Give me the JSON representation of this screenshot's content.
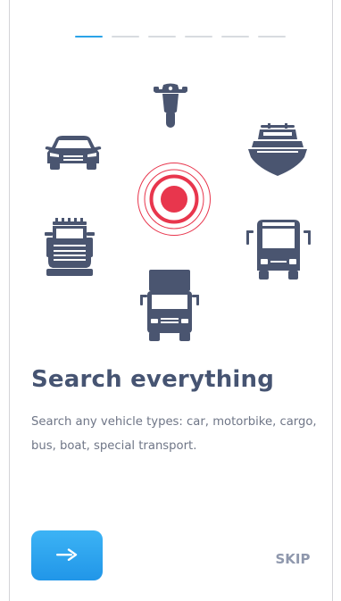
{
  "onboarding": {
    "pager": {
      "total": 6,
      "active_index": 0
    },
    "illustration": {
      "vehicles": [
        "motorbike",
        "car",
        "boat",
        "special-transport",
        "bus",
        "cargo"
      ],
      "center": "location-pulse"
    },
    "title": "Search everything",
    "description": "Search any vehicle types: car, motorbike, cargo, bus, boat, special transport.",
    "next_icon": "arrow-right-icon",
    "skip_label": "SKIP"
  },
  "colors": {
    "accent": "#2ba3e8",
    "vehicle_icon": "#4a5570",
    "pulse": "#e8364d",
    "title": "#465472",
    "text": "#6f7687",
    "skip": "#8f98ad"
  }
}
